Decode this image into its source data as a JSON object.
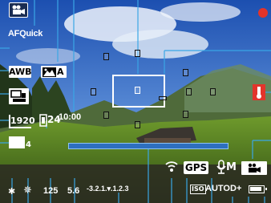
{
  "shooting_mode_icon": "movie-camera-icon",
  "af_method": "AFQuick",
  "white_balance": "AWB",
  "picture_style_icon": "picture-style-auto-icon",
  "picture_style": "A",
  "recording_time": "10:00",
  "movie_size": "1920",
  "frame_rate": "24",
  "dlo_icon": "auto-lighting-optimizer-icon",
  "dlo_level": "4",
  "shutter_speed": "125",
  "aperture": "5.6",
  "exposure_scale": "-3.2.1.▾.1.2.3",
  "wifi_icon": "wifi-icon",
  "gps": "GPS",
  "audio": "M",
  "audio_icon": "microphone-icon",
  "movie_servo_icon": "movie-servo-af-icon",
  "iso": "AUTO",
  "iso_label": "ISO",
  "highlight_tone": "D+",
  "battery_icon": "battery-icon",
  "ae_lock": "✱",
  "flash": "✵",
  "warning_color": "#e2342b",
  "warning_icon": "temperature-warning-icon",
  "record_indicator_icon": "record-dot-icon",
  "record_color": "#e2342b",
  "callout_color": "#3aa6e6"
}
